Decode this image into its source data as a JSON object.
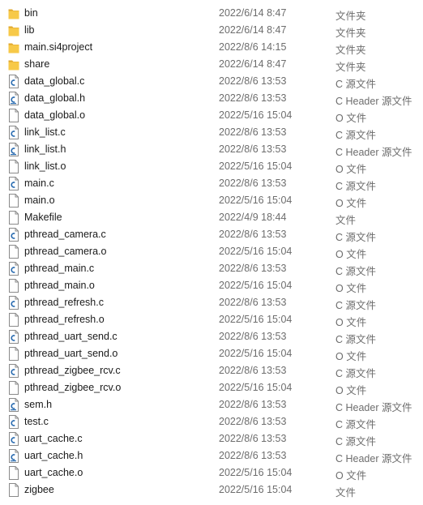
{
  "files": [
    {
      "name": "bin",
      "modified": "2022/6/14 8:47",
      "type": "文件夹",
      "icon": "folder-icon"
    },
    {
      "name": "lib",
      "modified": "2022/6/14 8:47",
      "type": "文件夹",
      "icon": "folder-icon"
    },
    {
      "name": "main.si4project",
      "modified": "2022/8/6 14:15",
      "type": "文件夹",
      "icon": "folder-icon"
    },
    {
      "name": "share",
      "modified": "2022/6/14 8:47",
      "type": "文件夹",
      "icon": "folder-icon"
    },
    {
      "name": "data_global.c",
      "modified": "2022/8/6 13:53",
      "type": "C 源文件",
      "icon": "c-source-file-icon"
    },
    {
      "name": "data_global.h",
      "modified": "2022/8/6 13:53",
      "type": "C Header 源文件",
      "icon": "c-header-file-icon"
    },
    {
      "name": "data_global.o",
      "modified": "2022/5/16 15:04",
      "type": "O 文件",
      "icon": "file-icon"
    },
    {
      "name": "link_list.c",
      "modified": "2022/8/6 13:53",
      "type": "C 源文件",
      "icon": "c-source-file-icon"
    },
    {
      "name": "link_list.h",
      "modified": "2022/8/6 13:53",
      "type": "C Header 源文件",
      "icon": "c-header-file-icon"
    },
    {
      "name": "link_list.o",
      "modified": "2022/5/16 15:04",
      "type": "O 文件",
      "icon": "file-icon"
    },
    {
      "name": "main.c",
      "modified": "2022/8/6 13:53",
      "type": "C 源文件",
      "icon": "c-source-file-icon"
    },
    {
      "name": "main.o",
      "modified": "2022/5/16 15:04",
      "type": "O 文件",
      "icon": "file-icon"
    },
    {
      "name": "Makefile",
      "modified": "2022/4/9 18:44",
      "type": "文件",
      "icon": "file-icon"
    },
    {
      "name": "pthread_camera.c",
      "modified": "2022/8/6 13:53",
      "type": "C 源文件",
      "icon": "c-source-file-icon"
    },
    {
      "name": "pthread_camera.o",
      "modified": "2022/5/16 15:04",
      "type": "O 文件",
      "icon": "file-icon"
    },
    {
      "name": "pthread_main.c",
      "modified": "2022/8/6 13:53",
      "type": "C 源文件",
      "icon": "c-source-file-icon"
    },
    {
      "name": "pthread_main.o",
      "modified": "2022/5/16 15:04",
      "type": "O 文件",
      "icon": "file-icon"
    },
    {
      "name": "pthread_refresh.c",
      "modified": "2022/8/6 13:53",
      "type": "C 源文件",
      "icon": "c-source-file-icon"
    },
    {
      "name": "pthread_refresh.o",
      "modified": "2022/5/16 15:04",
      "type": "O 文件",
      "icon": "file-icon"
    },
    {
      "name": "pthread_uart_send.c",
      "modified": "2022/8/6 13:53",
      "type": "C 源文件",
      "icon": "c-source-file-icon"
    },
    {
      "name": "pthread_uart_send.o",
      "modified": "2022/5/16 15:04",
      "type": "O 文件",
      "icon": "file-icon"
    },
    {
      "name": "pthread_zigbee_rcv.c",
      "modified": "2022/8/6 13:53",
      "type": "C 源文件",
      "icon": "c-source-file-icon"
    },
    {
      "name": "pthread_zigbee_rcv.o",
      "modified": "2022/5/16 15:04",
      "type": "O 文件",
      "icon": "file-icon"
    },
    {
      "name": "sem.h",
      "modified": "2022/8/6 13:53",
      "type": "C Header 源文件",
      "icon": "c-header-file-icon"
    },
    {
      "name": "test.c",
      "modified": "2022/8/6 13:53",
      "type": "C 源文件",
      "icon": "c-source-file-icon"
    },
    {
      "name": "uart_cache.c",
      "modified": "2022/8/6 13:53",
      "type": "C 源文件",
      "icon": "c-source-file-icon"
    },
    {
      "name": "uart_cache.h",
      "modified": "2022/8/6 13:53",
      "type": "C Header 源文件",
      "icon": "c-header-file-icon"
    },
    {
      "name": "uart_cache.o",
      "modified": "2022/5/16 15:04",
      "type": "O 文件",
      "icon": "file-icon"
    },
    {
      "name": "zigbee",
      "modified": "2022/5/16 15:04",
      "type": "文件",
      "icon": "file-icon"
    }
  ],
  "colors": {
    "folder": "#f7c948",
    "folder_dark": "#e0a82e",
    "code_accent": "#2b6cb0",
    "file_outline": "#8a8a8a"
  }
}
